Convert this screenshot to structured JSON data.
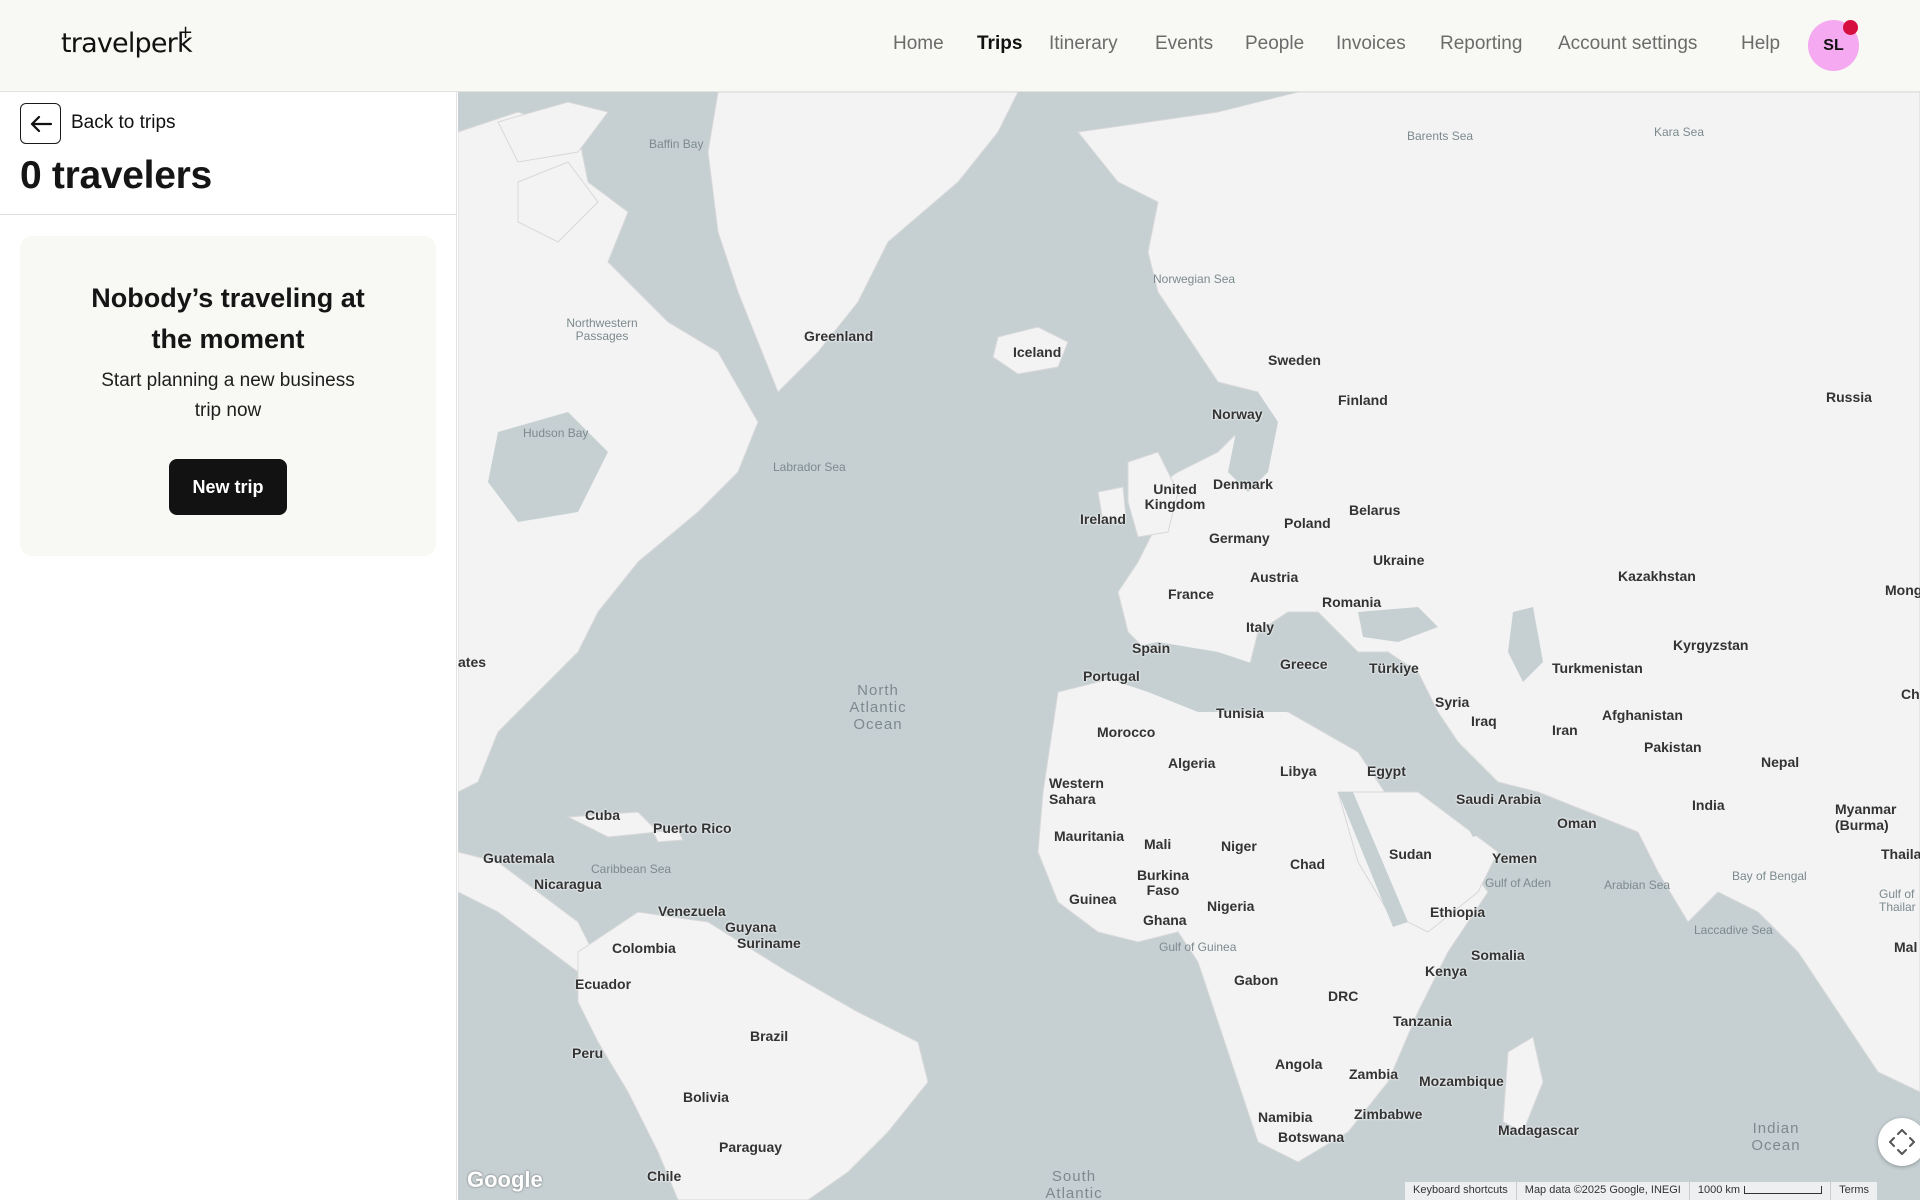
{
  "header": {
    "logo": "travelperk",
    "nav": [
      {
        "label": "Home",
        "active": false
      },
      {
        "label": "Trips",
        "active": true
      },
      {
        "label": "Itinerary",
        "active": false
      },
      {
        "label": "Events",
        "active": false
      },
      {
        "label": "People",
        "active": false
      },
      {
        "label": "Invoices",
        "active": false
      },
      {
        "label": "Reporting",
        "active": false
      },
      {
        "label": "Account settings",
        "active": false
      },
      {
        "label": "Help",
        "active": false
      }
    ],
    "avatar_initials": "SL"
  },
  "sidebar": {
    "back_label": "Back to trips",
    "title": "0 travelers",
    "empty_state": {
      "heading": "Nobody’s traveling at the moment",
      "subtext": "Start planning a new business trip now",
      "button_label": "New trip"
    }
  },
  "map": {
    "countries": [
      "Greenland",
      "Iceland",
      "Sweden",
      "Finland",
      "Norway",
      "Russia",
      "United Kingdom",
      "Ireland",
      "Denmark",
      "Belarus",
      "Poland",
      "Germany",
      "Ukraine",
      "Austria",
      "Kazakhstan",
      "France",
      "Romania",
      "Italy",
      "Spain",
      "Kyrgyzstan",
      "Greece",
      "Türkiye",
      "Turkmenistan",
      "Portugal",
      "Syria",
      "Tunisia",
      "Iraq",
      "Afghanistan",
      "Iran",
      "Morocco",
      "Pakistan",
      "Algeria",
      "Libya",
      "Egypt",
      "Nepal",
      "Western Sahara",
      "Saudi Arabia",
      "India",
      "Myanmar (Burma)",
      "Oman",
      "Mauritania",
      "Mali",
      "Niger",
      "Yemen",
      "Chad",
      "Sudan",
      "Burkina Faso",
      "Guinea",
      "Ghana",
      "Nigeria",
      "Ethiopia",
      "Somalia",
      "Kenya",
      "Gabon",
      "DRC",
      "Tanzania",
      "Angola",
      "Zambia",
      "Mozambique",
      "Namibia",
      "Zimbabwe",
      "Botswana",
      "Madagascar",
      "Cuba",
      "Puerto Rico",
      "Guatemala",
      "Nicaragua",
      "Venezuela",
      "Guyana",
      "Suriname",
      "Colombia",
      "Ecuador",
      "Brazil",
      "Peru",
      "Bolivia",
      "Paraguay",
      "Chile",
      "ates",
      "Mong",
      "Ch",
      "Thailar",
      "Mal"
    ],
    "seas": [
      "Baffin Bay",
      "Barents Sea",
      "Kara Sea",
      "Norwegian Sea",
      "Northwestern Passages",
      "Hudson Bay",
      "Labrador Sea",
      "Caribbean Sea",
      "Gulf of Guinea",
      "Gulf of Aden",
      "Arabian Sea",
      "Bay of Bengal",
      "Laccadive Sea",
      "Gulf of Thailar"
    ],
    "oceans": [
      "North Atlantic Ocean",
      "South Atlantic",
      "Indian Ocean"
    ],
    "google_logo": "Google",
    "footer": {
      "keyboard": "Keyboard shortcuts",
      "attribution": "Map data ©2025 Google, INEGI",
      "scale": "1000 km",
      "terms": "Terms"
    }
  },
  "icons": {
    "back": "arrow-left-icon",
    "fullscreen": "fullscreen-icon"
  },
  "colors": {
    "header_bg": "#f8f8f4",
    "avatar_bg": "#f4a9f0",
    "notification_dot": "#d5103f",
    "primary_button": "#121212",
    "map_water": "#c6d0d3",
    "map_land": "#f3f3f3"
  }
}
